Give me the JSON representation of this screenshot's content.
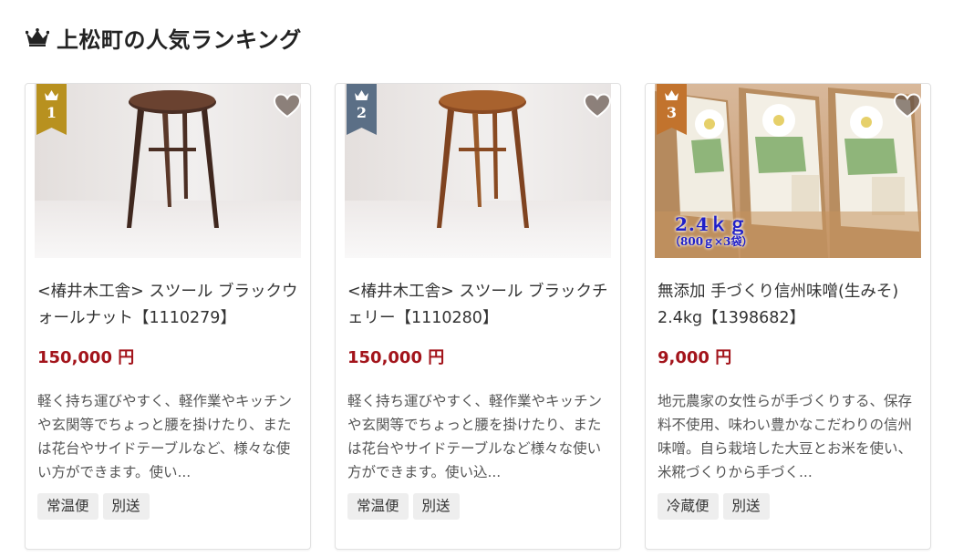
{
  "header": {
    "title": "上松町の人気ランキング",
    "icon": "crown-icon"
  },
  "colors": {
    "price": "#a3141b",
    "rank_1": "#b8911f",
    "rank_2": "#5b6f86",
    "rank_3": "#c2732d"
  },
  "products": [
    {
      "rank": "1",
      "name": "<椿井木工舎> スツール ブラックウォールナット【1110279】",
      "price": "150,000 円",
      "description": "軽く持ち運びやすく、軽作業やキッチンや玄関等でちょっと腰を掛けたり、または花台やサイドテーブルなど、様々な使い方ができます。使い...",
      "tags": [
        "常温便",
        "別送"
      ],
      "image": "stool-walnut-photo"
    },
    {
      "rank": "2",
      "name": "<椿井木工舎> スツール ブラックチェリー【1110280】",
      "price": "150,000 円",
      "description": "軽く持ち運びやすく、軽作業やキッチンや玄関等でちょっと腰を掛けたり、または花台やサイドテーブルなど様々な使い方ができます。使い込...",
      "tags": [
        "常温便",
        "別送"
      ],
      "image": "stool-cherry-photo"
    },
    {
      "rank": "3",
      "name": "無添加 手づくり信州味噌(生みそ) 2.4kg【1398682】",
      "price": "9,000 円",
      "description": "地元農家の女性らが手づくりする、保存料不使用、味わい豊かなこだわりの信州味噌。自ら栽培した大豆とお米を使い、米糀づくりから手づく...",
      "tags": [
        "冷蔵便",
        "別送"
      ],
      "image": "miso-bags-photo",
      "image_caption": "2.4ｋｇ",
      "image_subcaption": "（800ｇ×3袋）"
    }
  ]
}
